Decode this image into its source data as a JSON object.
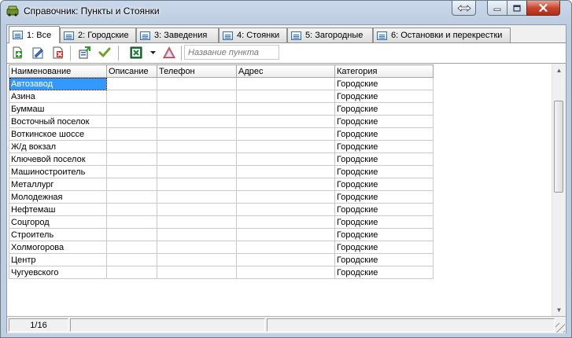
{
  "window": {
    "title": "Справочник:  Пункты и Стоянки"
  },
  "tabs": [
    {
      "label": "1: Все"
    },
    {
      "label": "2: Городские"
    },
    {
      "label": "3: Заведения"
    },
    {
      "label": "4: Стоянки"
    },
    {
      "label": "5: Загородные"
    },
    {
      "label": "6: Остановки и перекрестки"
    }
  ],
  "active_tab": "1: Все",
  "toolbar": {
    "search_placeholder": "Название пункта",
    "icons": [
      "add-record-icon",
      "edit-record-icon",
      "delete-record-icon",
      "properties-icon",
      "checkmark-icon",
      "excel-export-icon",
      "dropdown-arrow-icon",
      "warning-triangle-icon"
    ]
  },
  "grid": {
    "columns": [
      "Наименование",
      "Описание",
      "Телефон",
      "Адрес",
      "Категория"
    ],
    "rows": [
      [
        "Автозавод",
        "",
        "",
        "",
        "Городские"
      ],
      [
        "Азина",
        "",
        "",
        "",
        "Городские"
      ],
      [
        "Буммаш",
        "",
        "",
        "",
        "Городские"
      ],
      [
        "Восточный поселок",
        "",
        "",
        "",
        "Городские"
      ],
      [
        "Воткинское шоссе",
        "",
        "",
        "",
        "Городские"
      ],
      [
        "Ж/д вокзал",
        "",
        "",
        "",
        "Городские"
      ],
      [
        "Ключевой поселок",
        "",
        "",
        "",
        "Городские"
      ],
      [
        "Машиностроитель",
        "",
        "",
        "",
        "Городские"
      ],
      [
        "Металлург",
        "",
        "",
        "",
        "Городские"
      ],
      [
        "Молодежная",
        "",
        "",
        "",
        "Городские"
      ],
      [
        "Нефтемаш",
        "",
        "",
        "",
        "Городские"
      ],
      [
        "Соцгород",
        "",
        "",
        "",
        "Городские"
      ],
      [
        "Строитель",
        "",
        "",
        "",
        "Городские"
      ],
      [
        "Холмогорова",
        "",
        "",
        "",
        "Городские"
      ],
      [
        "Центр",
        "",
        "",
        "",
        "Городские"
      ],
      [
        "Чугуевского",
        "",
        "",
        "",
        "Городские"
      ]
    ],
    "selected_row": 1
  },
  "status": {
    "record_position": "1/16"
  },
  "colors": {
    "selection": "#3399ff",
    "close_button": "#c8472f",
    "titlebar": "#c9d8ea"
  }
}
